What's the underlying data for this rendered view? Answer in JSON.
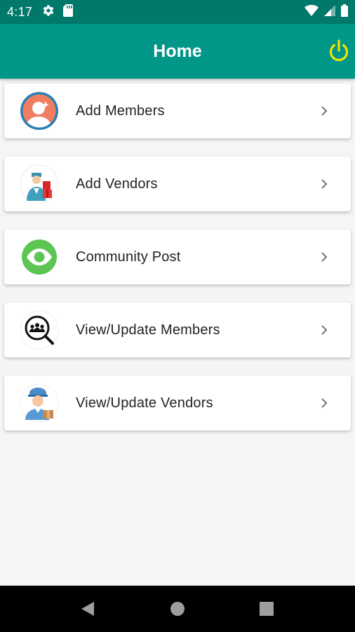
{
  "status_bar": {
    "time": "4:17",
    "icons": [
      "settings-icon",
      "sd-card-icon",
      "wifi-icon",
      "cellular-signal-icon",
      "battery-icon"
    ],
    "background": "#00796b"
  },
  "app_bar": {
    "title": "Home",
    "background": "#009688",
    "power_icon": "power-icon",
    "power_icon_color": "#f2e600"
  },
  "menu": {
    "items": [
      {
        "label": "Add Members",
        "icon": "add-member-avatar-icon"
      },
      {
        "label": "Add Vendors",
        "icon": "delivery-vendor-icon"
      },
      {
        "label": "Community Post",
        "icon": "eye-icon"
      },
      {
        "label": "View/Update Members",
        "icon": "search-members-icon"
      },
      {
        "label": "View/Update Vendors",
        "icon": "vendor-avatar-icon"
      }
    ],
    "chevron_icon": "chevron-right-icon"
  },
  "nav_bar": {
    "buttons": [
      "back-icon",
      "home-icon",
      "recents-icon"
    ]
  }
}
